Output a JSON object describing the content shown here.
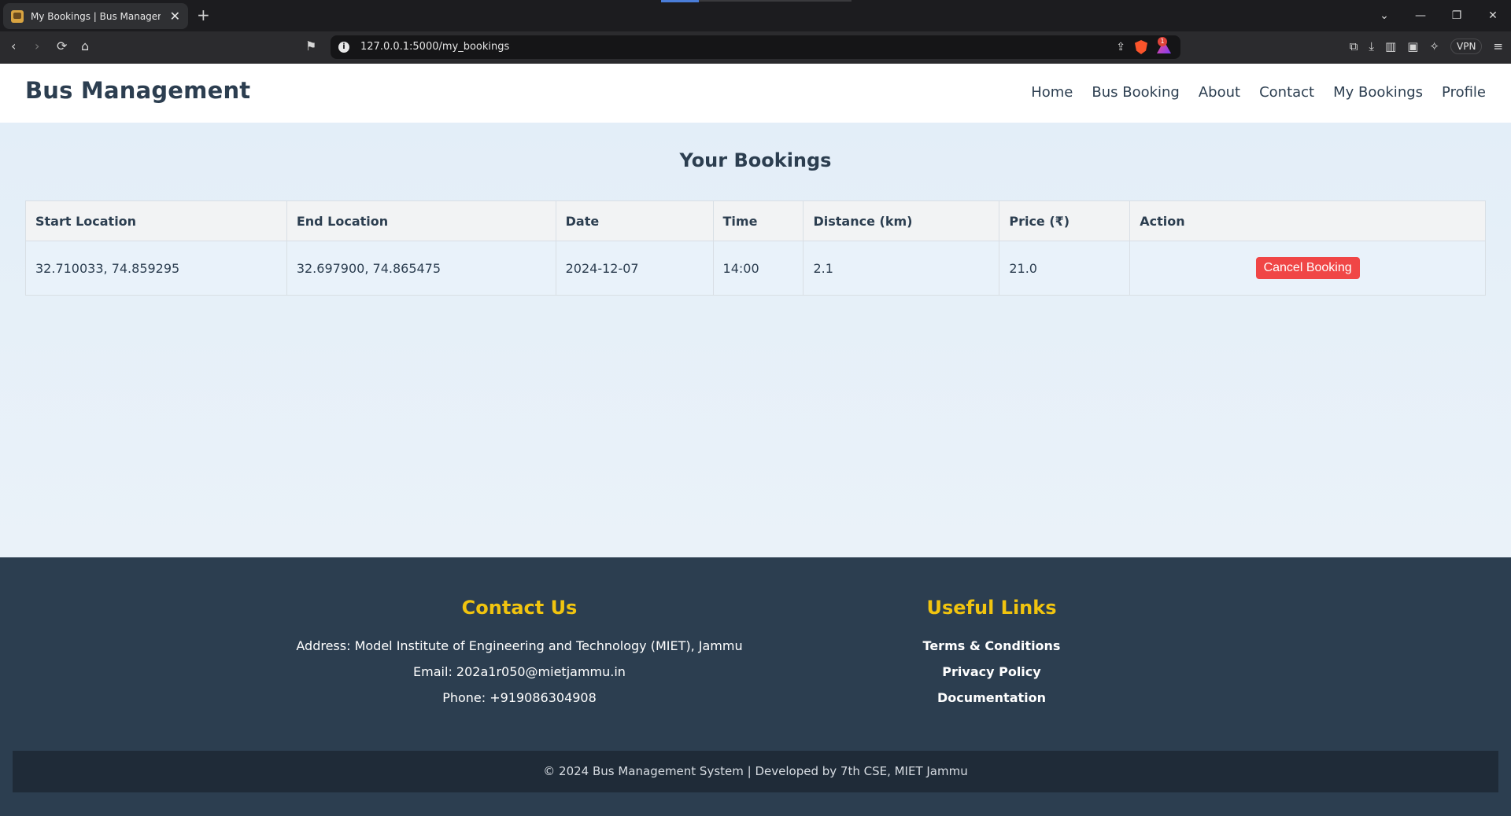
{
  "browser": {
    "tab_title": "My Bookings | Bus Management",
    "url": "127.0.0.1:5000/my_bookings",
    "vpn_label": "VPN",
    "rewards_badge": "1"
  },
  "site": {
    "brand": "Bus Management",
    "nav": [
      "Home",
      "Bus Booking",
      "About",
      "Contact",
      "My Bookings",
      "Profile"
    ]
  },
  "main": {
    "heading": "Your Bookings",
    "columns": [
      "Start Location",
      "End Location",
      "Date",
      "Time",
      "Distance (km)",
      "Price (₹)",
      "Action"
    ],
    "rows": [
      {
        "start": "32.710033, 74.859295",
        "end": "32.697900, 74.865475",
        "date": "2024-12-07",
        "time": "14:00",
        "distance": "2.1",
        "price": "21.0",
        "action": "Cancel Booking"
      }
    ]
  },
  "footer": {
    "contact_heading": "Contact Us",
    "address": "Address: Model Institute of Engineering and Technology (MIET), Jammu",
    "email": "Email: 202a1r050@mietjammu.in",
    "phone": "Phone: +919086304908",
    "links_heading": "Useful Links",
    "links": [
      "Terms & Conditions",
      "Privacy Policy",
      "Documentation"
    ],
    "copyright": "© 2024 Bus Management System | Developed by 7th CSE, MIET Jammu"
  },
  "colors": {
    "accent": "#f1c40f",
    "footer_bg": "#2c3e50",
    "danger": "#f04646"
  }
}
